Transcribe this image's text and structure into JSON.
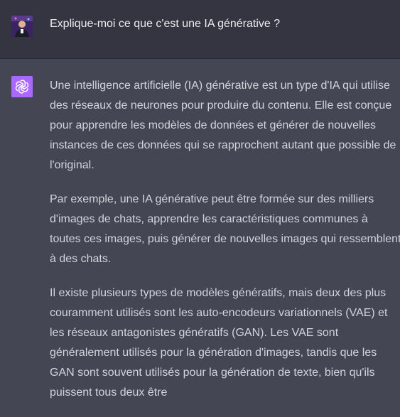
{
  "user": {
    "question": "Explique-moi ce que c'est une IA générative ?"
  },
  "assistant": {
    "paragraphs": [
      {
        "lines": [
          "Une intelligence artificielle (IA) générative est un type d'IA qui utilise",
          "des réseaux de neurones pour produire du contenu. Elle est conçue",
          "pour apprendre les modèles de données et générer de nouvelles",
          "instances de ces données qui se rapprochent autant que possible de",
          "l'original."
        ]
      },
      {
        "lines": [
          "Par exemple, une IA générative peut être formée sur des milliers",
          "d'images de chats, apprendre les caractéristiques communes à",
          "toutes ces images, puis générer de nouvelles images qui ressemblent",
          "à des chats."
        ]
      },
      {
        "lines": [
          "Il existe plusieurs types de modèles génératifs, mais deux des plus",
          "couramment utilisés sont les auto-encodeurs variationnels (VAE) et",
          "les réseaux antagonistes génératifs (GAN). Les VAE sont",
          "généralement utilisés pour la génération d'images, tandis que les",
          "GAN sont souvent utilisés pour la génération de texte, bien qu'ils",
          "puissent tous deux être"
        ]
      }
    ]
  },
  "colors": {
    "user_bg": "#343541",
    "assistant_bg": "#444654",
    "gpt_icon_bg": "#ab68ff",
    "text": "#d1d5db"
  },
  "icons": {
    "user_avatar": "user-avatar-photo",
    "assistant_avatar": "openai-logo-icon"
  }
}
